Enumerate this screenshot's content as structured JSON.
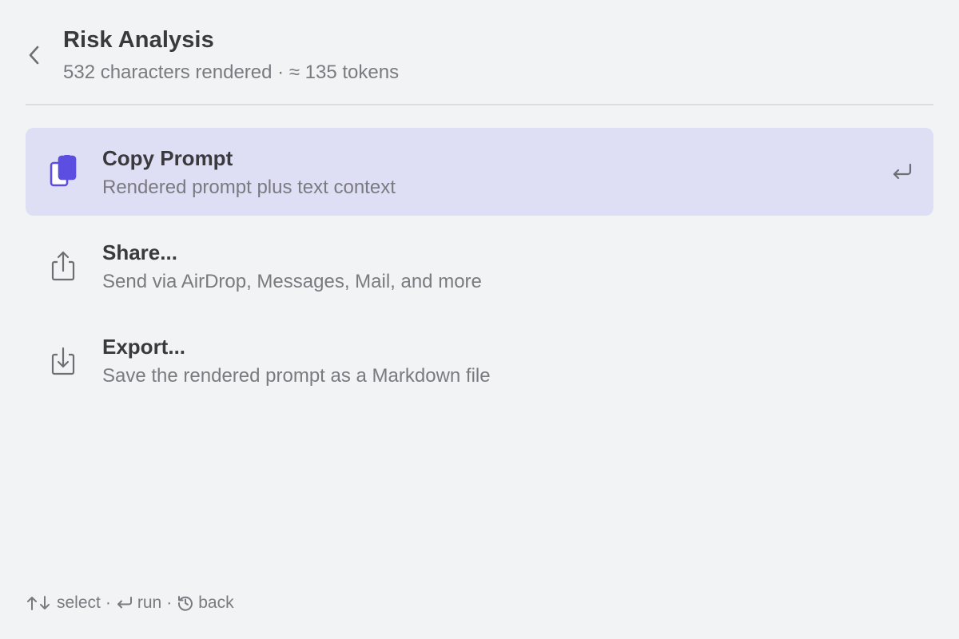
{
  "header": {
    "back_icon": "chevron-left-icon",
    "title": "Risk Analysis",
    "subtitle": "532 characters rendered · ≈ 135 tokens"
  },
  "items": [
    {
      "title": "Copy Prompt",
      "description": "Rendered prompt plus text context",
      "icon": "copy-icon",
      "selected": true,
      "shortcut_icon": "return-icon"
    },
    {
      "title": "Share...",
      "description": "Send via AirDrop, Messages, Mail, and more",
      "icon": "share-icon",
      "selected": false
    },
    {
      "title": "Export...",
      "description": "Save the rendered prompt as a Markdown file",
      "icon": "download-icon",
      "selected": false
    }
  ],
  "footer": {
    "select_label": "select",
    "run_label": "run",
    "back_label": "back",
    "separator": "·"
  },
  "colors": {
    "background": "#f2f3f5",
    "selected_row": "#dedff4",
    "accent_icon": "#5b4ee0",
    "primary_text": "#3a3a3e",
    "secondary_text": "#7a7a80"
  }
}
